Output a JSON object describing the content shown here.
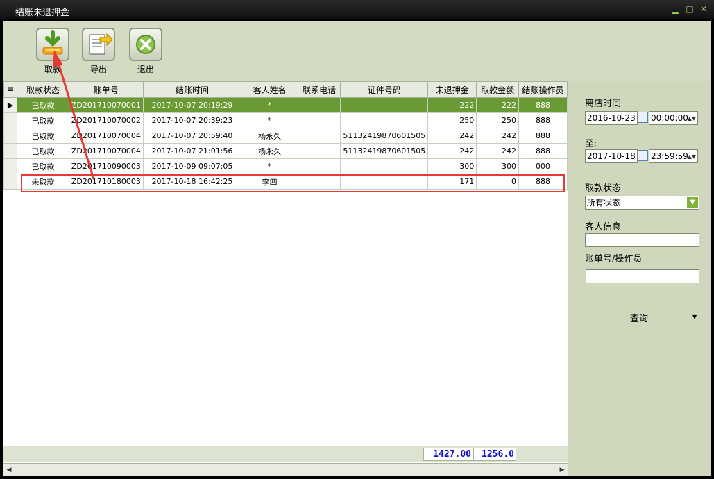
{
  "window": {
    "title": "结账未退押金"
  },
  "toolbar": [
    {
      "label": "取款",
      "icon": "withdraw-icon"
    },
    {
      "label": "导出",
      "icon": "export-icon"
    },
    {
      "label": "退出",
      "icon": "exit-icon"
    }
  ],
  "table": {
    "columns": [
      "取款状态",
      "账单号",
      "结账时间",
      "客人姓名",
      "联系电话",
      "证件号码",
      "未退押金",
      "取款金额",
      "结账操作员"
    ],
    "rows": [
      {
        "status": "已取款",
        "bill": "ZD201710070001",
        "time": "2017-10-07 20:19:29",
        "guest": "*",
        "phone": "",
        "id_no": "",
        "deposit": "222",
        "withdrawn": "222",
        "operator": "888"
      },
      {
        "status": "已取款",
        "bill": "ZD201710070002",
        "time": "2017-10-07 20:39:23",
        "guest": "*",
        "phone": "",
        "id_no": "",
        "deposit": "250",
        "withdrawn": "250",
        "operator": "888"
      },
      {
        "status": "已取款",
        "bill": "ZD201710070004",
        "time": "2017-10-07 20:59:40",
        "guest": "杨永久",
        "phone": "",
        "id_no": "51132419870601505",
        "deposit": "242",
        "withdrawn": "242",
        "operator": "888"
      },
      {
        "status": "已取款",
        "bill": "ZD201710070004",
        "time": "2017-10-07 21:01:56",
        "guest": "杨永久",
        "phone": "",
        "id_no": "51132419870601505",
        "deposit": "242",
        "withdrawn": "242",
        "operator": "888"
      },
      {
        "status": "已取款",
        "bill": "ZD201710090003",
        "time": "2017-10-09 09:07:05",
        "guest": "*",
        "phone": "",
        "id_no": "",
        "deposit": "300",
        "withdrawn": "300",
        "operator": "000"
      },
      {
        "status": "未取款",
        "bill": "ZD201710180003",
        "time": "2017-10-18 16:42:25",
        "guest": "李四",
        "phone": "",
        "id_no": "",
        "deposit": "171",
        "withdrawn": "0",
        "operator": "888"
      }
    ],
    "totals": {
      "deposit": "1427.00",
      "withdrawn": "1256.0"
    }
  },
  "filter": {
    "checkout_label": "离店时间",
    "from_date": "2016-10-23",
    "from_time": "00:00:00",
    "to_label": "至:",
    "to_date": "2017-10-18",
    "to_time": "23:59:59",
    "status_label": "取款状态",
    "status_value": "所有状态",
    "guest_label": "客人信息",
    "guest_value": "",
    "bill_label": "账单号/操作员",
    "bill_value": "",
    "query_label": "查询"
  },
  "colors": {
    "selected_row": "#6a9a33",
    "highlight": "#e53935",
    "panel_bg": "#cfd8bd"
  }
}
